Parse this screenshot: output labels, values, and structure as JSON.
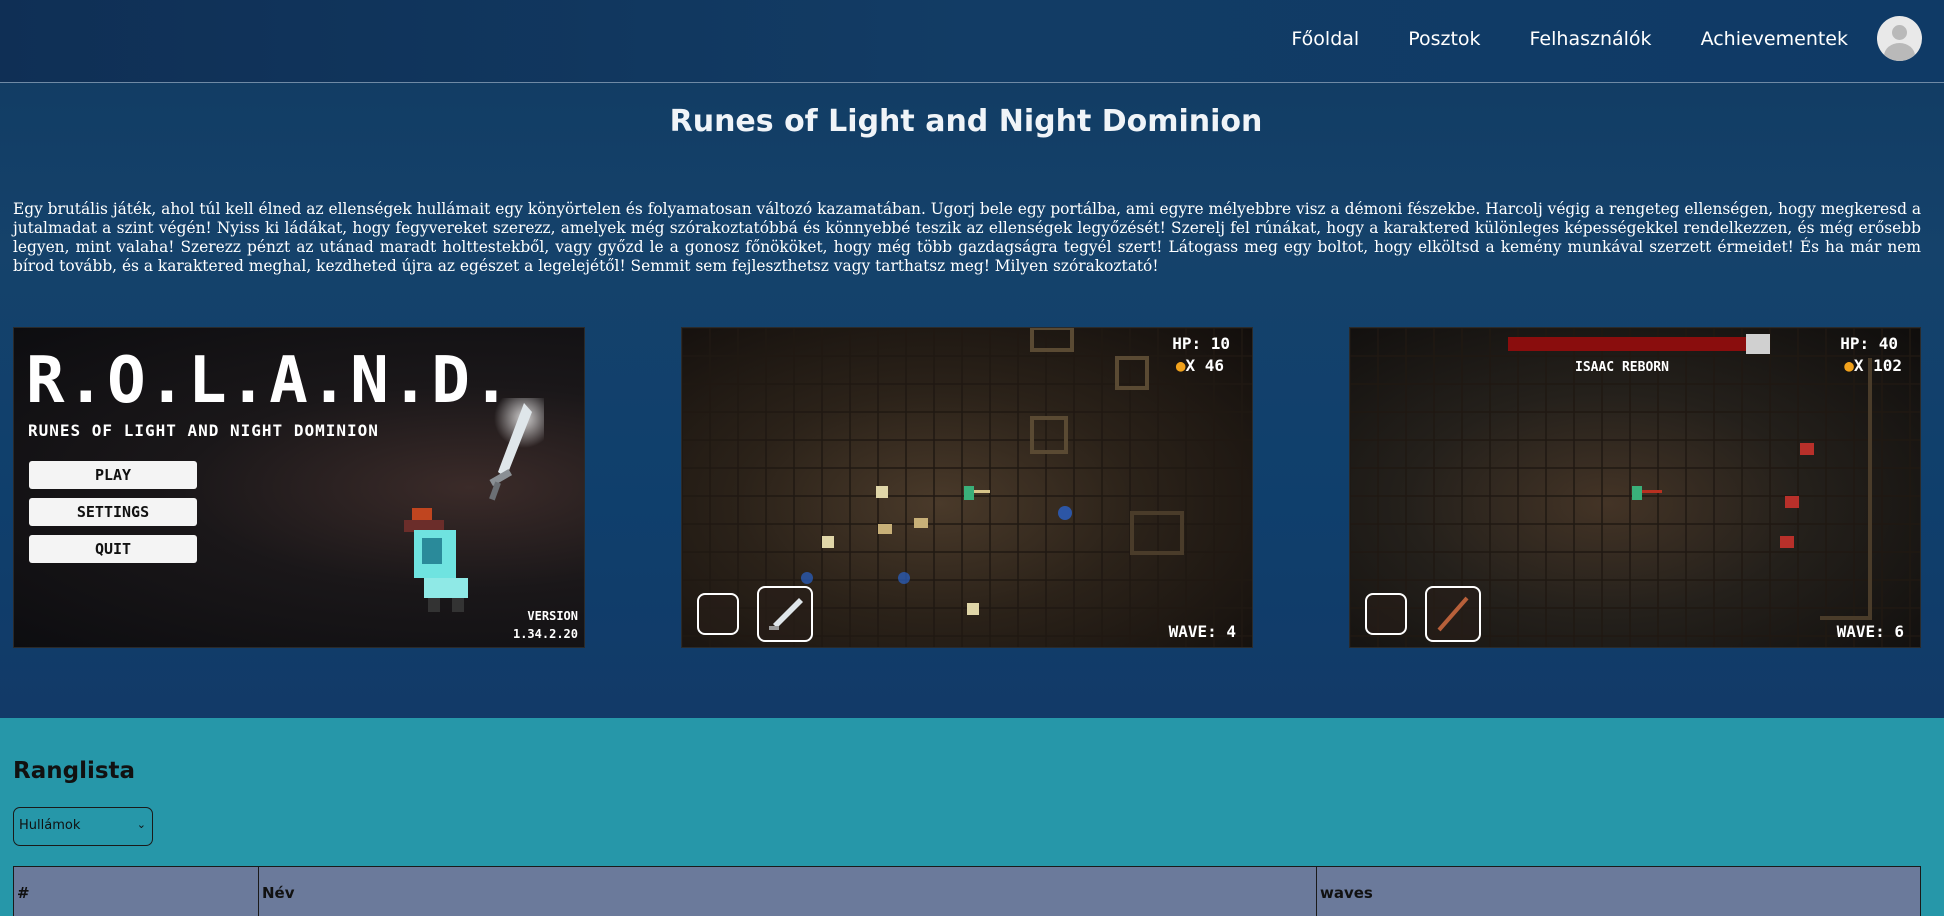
{
  "nav": {
    "links": [
      "Főoldal",
      "Posztok",
      "Felhasználók",
      "Achievementek"
    ]
  },
  "game": {
    "title": "Runes of Light and Night Dominion",
    "description": "Egy brutális játék, ahol túl kell élned az ellenségek hullámait egy könyörtelen és folyamatosan változó kazamatában. Ugorj bele egy portálba, ami egyre mélyebbre visz a démoni fészekbe. Harcolj végig a rengeteg ellenségen, hogy megkeresd a jutalmadat a szint végén! Nyiss ki ládákat, hogy fegyvereket szerezz, amelyek még szórakoztatóbbá és könnyebbé teszik az ellenségek legyőzését! Szerelj fel rúnákat, hogy a karaktered különleges képességekkel rendelkezzen, és még erősebb legyen, mint valaha! Szerezz pénzt az utánad maradt holttestekből, vagy győzd le a gonosz főnököket, hogy még több gazdagságra tegyél szert! Látogass meg egy boltot, hogy elköltsd a kemény munkával szerzett érmeidet! És ha már nem bírod tovább, és a karaktered meghal, kezdheted újra az egészet a legelejétől! Semmit sem fejleszthetsz vagy tarthatsz meg! Milyen szórakoztató!"
  },
  "screenshots": {
    "menu": {
      "logo": "R.O.L.A.N.D.",
      "subtitle": "RUNES OF LIGHT AND NIGHT DOMINION",
      "buttons": [
        "PLAY",
        "SETTINGS",
        "QUIT"
      ],
      "version_label": "VERSION",
      "version": "1.34.2.20"
    },
    "gameplay1": {
      "hp": "HP: 10",
      "coins": "X 46",
      "wave": "WAVE: 4"
    },
    "gameplay2": {
      "boss": "ISAAC REBORN",
      "hp": "HP: 40",
      "coins": "X 102",
      "wave": "WAVE: 6"
    }
  },
  "leaderboard": {
    "title": "Ranglista",
    "selected": "Hullámok",
    "columns": [
      "#",
      "Név",
      "waves"
    ]
  },
  "colors": {
    "header_bg": "#123c65",
    "lower_bg": "#2697a9",
    "table_header_bg": "#6b7a9b"
  }
}
